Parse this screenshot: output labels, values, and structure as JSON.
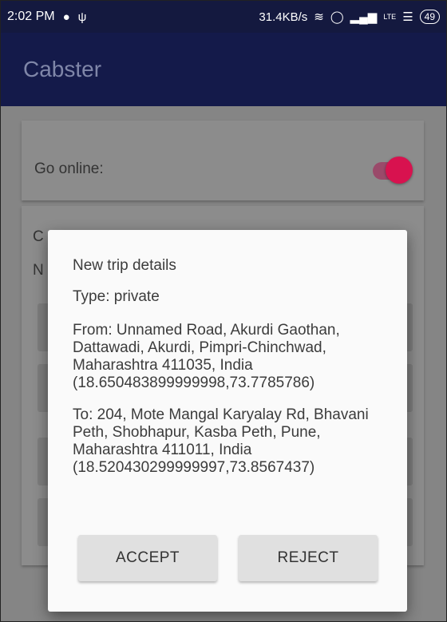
{
  "status_bar": {
    "time": "2:02 PM",
    "network_speed": "31.4KB/s",
    "battery": "49",
    "icons": [
      "chat-icon",
      "usb-icon",
      "vibrate-icon",
      "alarm-icon",
      "signal-icon",
      "volte-icon",
      "wifi-icon",
      "battery-icon"
    ]
  },
  "app_bar": {
    "title": "Cabster"
  },
  "online_card": {
    "label": "Go online:",
    "toggle_on": true
  },
  "trip_card": {
    "peek_heading": "C",
    "peek_line": "N"
  },
  "dialog": {
    "title": "New trip details",
    "type": "Type: private",
    "from": "From: Unnamed Road, Akurdi Gaothan, Dattawadi, Akurdi, Pimpri-Chinchwad, Maharashtra 411035, India (18.650483899999998,73.7785786)",
    "to": "To: 204, Mote Mangal Karyalay Rd, Bhavani Peth, Shobhapur, Kasba Peth, Pune, Maharashtra 411011, India (18.520430299999997,73.8567437)",
    "accept_label": "ACCEPT",
    "reject_label": "REJECT"
  },
  "colors": {
    "app_bar": "#141a4a",
    "status_bar": "#14193f",
    "toggle_accent": "#d8124f",
    "dialog_bg": "#fafafa",
    "button_bg": "#e0e0e0"
  }
}
